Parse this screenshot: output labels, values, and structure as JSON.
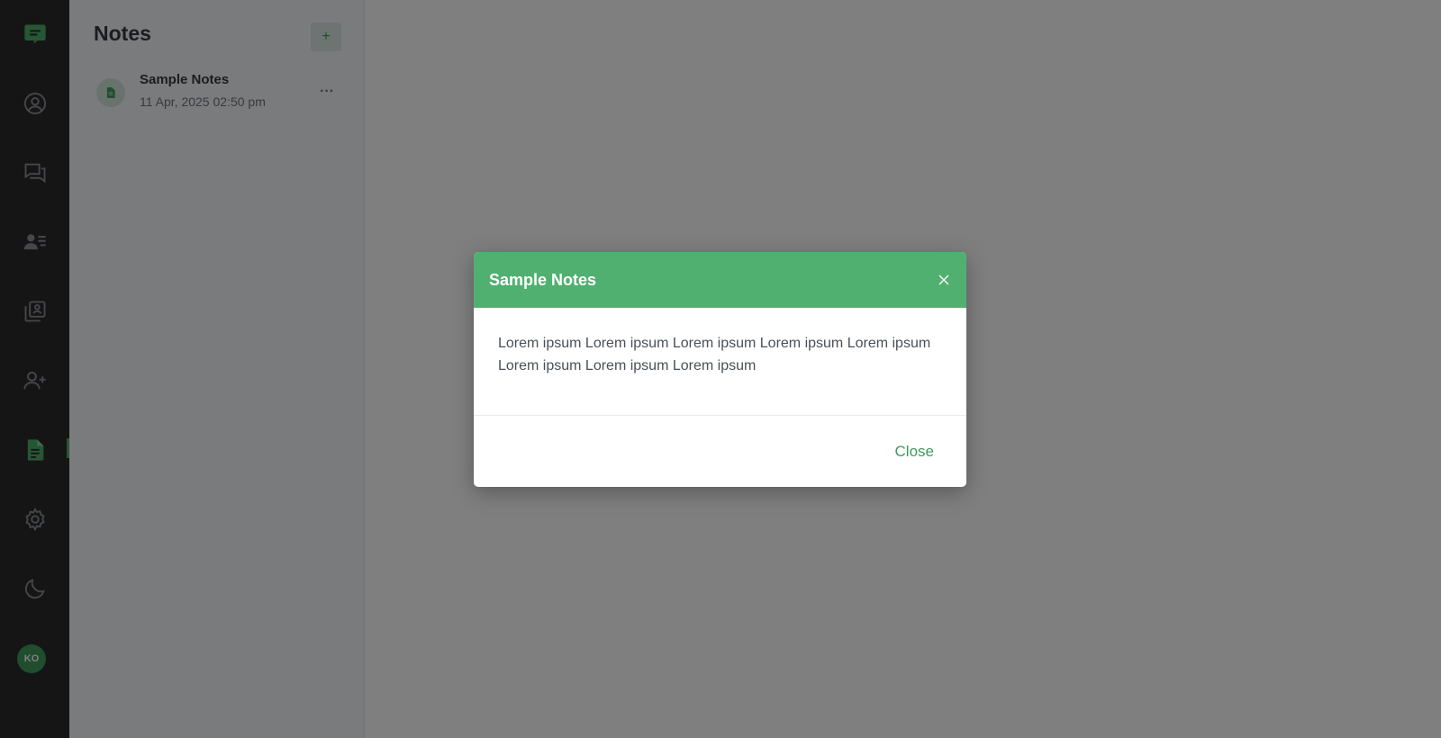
{
  "rail": {
    "items": [
      {
        "icon": "chat-logo-icon"
      },
      {
        "icon": "user-profile-icon"
      },
      {
        "icon": "chats-icon"
      },
      {
        "icon": "contacts-icon"
      },
      {
        "icon": "bookmarks-icon"
      },
      {
        "icon": "add-user-icon"
      },
      {
        "icon": "notes-icon"
      },
      {
        "icon": "settings-icon"
      },
      {
        "icon": "dark-mode-icon"
      }
    ],
    "avatar_initials": "KO"
  },
  "notes_panel": {
    "title": "Notes",
    "add_label": "+",
    "items": [
      {
        "name": "Sample Notes",
        "date": "11 Apr, 2025 02:50 pm",
        "menu": "···"
      }
    ]
  },
  "modal": {
    "title": "Sample Notes",
    "body": "Lorem ipsum Lorem ipsum Lorem ipsum Lorem ipsum Lorem ipsum Lorem ipsum Lorem ipsum Lorem ipsum",
    "close_label": "Close"
  },
  "colors": {
    "accent": "#50b06f",
    "rail_bg": "#2b2b2b",
    "panel_bg": "#f5f7fb"
  }
}
